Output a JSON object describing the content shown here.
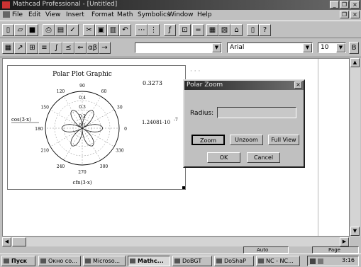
{
  "window": {
    "title": "Mathcad Professional - [Untitled]",
    "min_label": "_",
    "restore_label": "❐",
    "close_label": "×"
  },
  "menu": {
    "items": [
      "File",
      "Edit",
      "View",
      "Insert",
      "Format",
      "Math",
      "Symbolics",
      "Window",
      "Help"
    ]
  },
  "toolbar2": {
    "style_value": "",
    "font_value": "Arial",
    "size_value": "10"
  },
  "plot": {
    "title": "Polar Plot Graphic",
    "max_label": "0.3273",
    "min_label": "1.24081·10",
    "min_exp": "-7",
    "r_label": "cos(3·x)",
    "theta_label": "cfn(3·x)",
    "angles": [
      "90",
      "60",
      "30",
      "0",
      "330",
      "300",
      "270",
      "240",
      "210",
      "180",
      "150",
      "120"
    ],
    "radii": [
      "0.4",
      "0.3",
      "0.2",
      "0.1"
    ]
  },
  "dialog": {
    "title": "Polar Zoom",
    "radius_label": "Radius:",
    "radius_value": "",
    "zoom_label": "Zoom",
    "unzoom_label": "Unzoom",
    "fullview_label": "Full View",
    "ok_label": "OK",
    "cancel_label": "Cancel"
  },
  "status": {
    "mode": "Auto",
    "page": "Page"
  },
  "taskbar": {
    "start_label": "Пуск",
    "tasks": [
      "Окно со...",
      "Microso...",
      "Mathc...",
      "DoBGT",
      "DoShaP",
      "NC - NC..."
    ],
    "clock": "3:16"
  }
}
